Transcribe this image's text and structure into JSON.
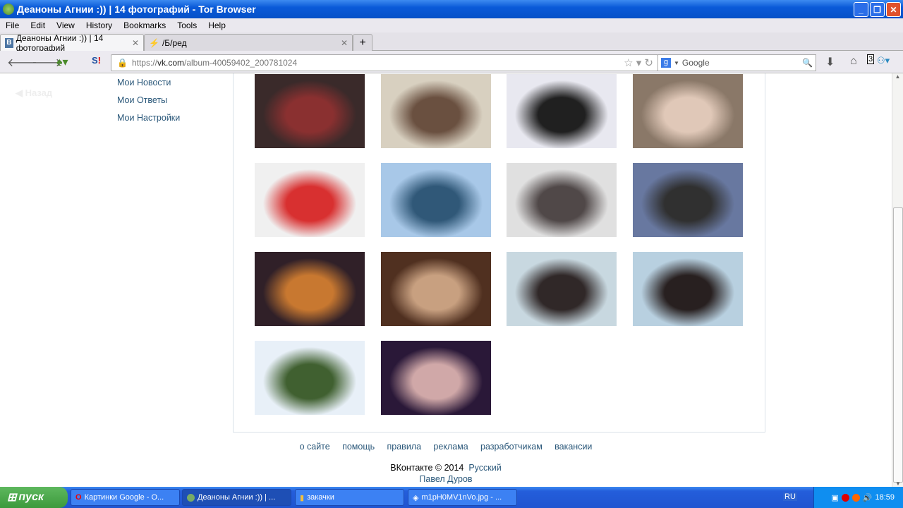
{
  "window": {
    "title": "Деаноны Агнии :)) | 14 фотографий - Tor Browser"
  },
  "menu": [
    "File",
    "Edit",
    "View",
    "History",
    "Bookmarks",
    "Tools",
    "Help"
  ],
  "tabs": [
    {
      "label": "Деаноны Агнии :)) | 14 фотографий",
      "icon": "vk-icon"
    },
    {
      "label": "/Б/ред",
      "icon": "lightning-icon"
    }
  ],
  "address": {
    "prefix": "https://",
    "domain": "vk.com",
    "path": "/album-40059402_200781024"
  },
  "search": {
    "placeholder": "Google"
  },
  "badge": "3",
  "back": "Назад",
  "leftnav": [
    "Мои Новости",
    "Мои Ответы",
    "Мои Настройки"
  ],
  "photos": [
    {
      "c1": "#3a2a2a",
      "c2": "#8a3030"
    },
    {
      "c1": "#d8d0c0",
      "c2": "#6a5040"
    },
    {
      "c1": "#e8e8f0",
      "c2": "#202020"
    },
    {
      "c1": "#8a7868",
      "c2": "#e0c8b8"
    },
    {
      "c1": "#f0f0f0",
      "c2": "#d83030"
    },
    {
      "c1": "#a8c8e8",
      "c2": "#305878"
    },
    {
      "c1": "#e0e0e0",
      "c2": "#504848"
    },
    {
      "c1": "#6878a0",
      "c2": "#303030"
    },
    {
      "c1": "#302028",
      "c2": "#c87830"
    },
    {
      "c1": "#503020",
      "c2": "#c8a080"
    },
    {
      "c1": "#c8d8e0",
      "c2": "#302828"
    },
    {
      "c1": "#b8d0e0",
      "c2": "#282020"
    },
    {
      "c1": "#e8f0f8",
      "c2": "#406030"
    },
    {
      "c1": "#2a1838",
      "c2": "#d0a8a8"
    }
  ],
  "footer": {
    "links": [
      "о сайте",
      "помощь",
      "правила",
      "реклама",
      "разработчикам",
      "вакансии"
    ],
    "copyright": "ВКонтакте © 2014",
    "language": "Русский",
    "author": "Павел Дуров"
  },
  "taskbar": {
    "start": "пуск",
    "tasks": [
      "Картинки Google - O...",
      "Деаноны Агнии :)) | ...",
      "закачки",
      "m1pH0MV1nVo.jpg - ..."
    ],
    "lang": "RU",
    "time": "18:59"
  }
}
